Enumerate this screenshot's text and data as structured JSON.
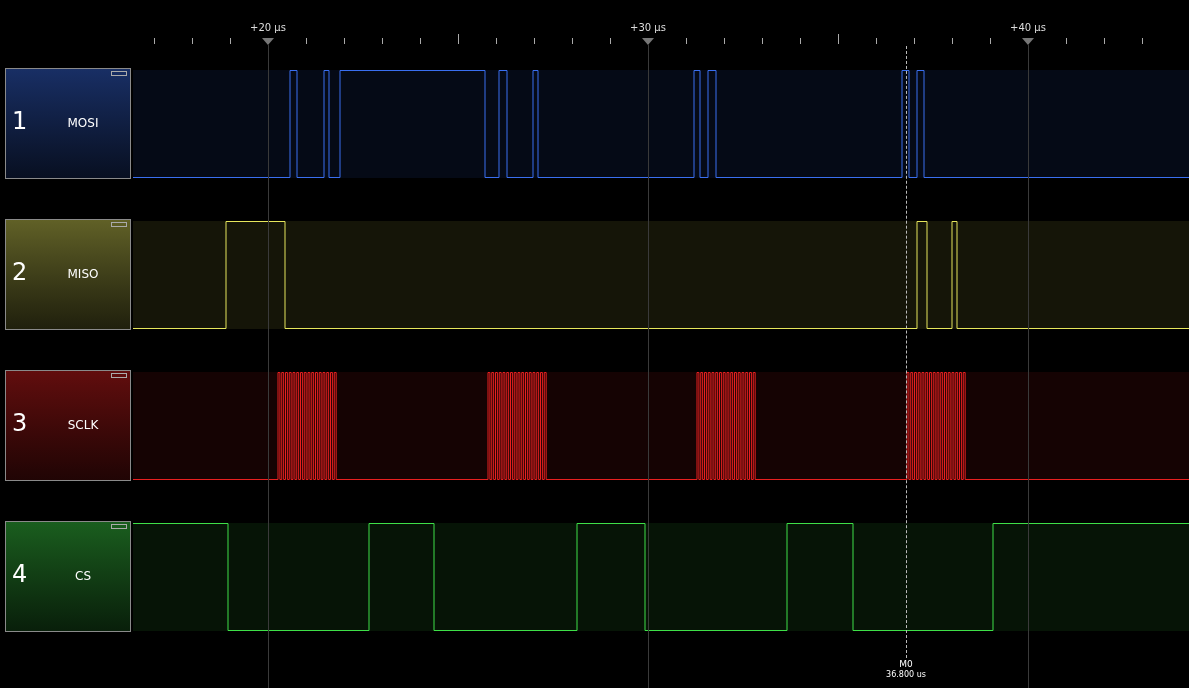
{
  "ruler": {
    "labels": [
      "+20 µs",
      "+30 µs",
      "+40 µs"
    ]
  },
  "channels": [
    {
      "number": "1",
      "name": "MOSI",
      "color": "#3a6ff0"
    },
    {
      "number": "2",
      "name": "MISO",
      "color": "#e6e65c"
    },
    {
      "number": "3",
      "name": "SCLK",
      "color": "#e82020"
    },
    {
      "number": "4",
      "name": "CS",
      "color": "#3ee048"
    }
  ],
  "marker": {
    "label": "M0",
    "time": "36.800 us"
  }
}
